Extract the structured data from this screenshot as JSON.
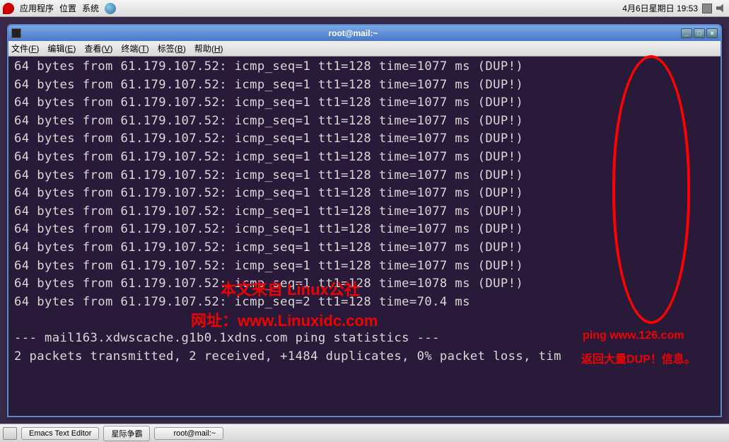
{
  "top_panel": {
    "menus": [
      "应用程序",
      "位置",
      "系统"
    ],
    "clock": "4月6日星期日 19:53"
  },
  "window": {
    "title": "root@mail:~",
    "menus": [
      {
        "label": "文件",
        "key": "F"
      },
      {
        "label": "编辑",
        "key": "E"
      },
      {
        "label": "查看",
        "key": "V"
      },
      {
        "label": "终端",
        "key": "T"
      },
      {
        "label": "标签",
        "key": "B"
      },
      {
        "label": "帮助",
        "key": "H"
      }
    ]
  },
  "terminal": {
    "lines": [
      "64 bytes from 61.179.107.52: icmp_seq=1 tt1=128 time=1077 ms (DUP!)",
      "64 bytes from 61.179.107.52: icmp_seq=1 tt1=128 time=1077 ms (DUP!)",
      "64 bytes from 61.179.107.52: icmp_seq=1 tt1=128 time=1077 ms (DUP!)",
      "64 bytes from 61.179.107.52: icmp_seq=1 tt1=128 time=1077 ms (DUP!)",
      "64 bytes from 61.179.107.52: icmp_seq=1 tt1=128 time=1077 ms (DUP!)",
      "64 bytes from 61.179.107.52: icmp_seq=1 tt1=128 time=1077 ms (DUP!)",
      "64 bytes from 61.179.107.52: icmp_seq=1 tt1=128 time=1077 ms (DUP!)",
      "64 bytes from 61.179.107.52: icmp_seq=1 tt1=128 time=1077 ms (DUP!)",
      "64 bytes from 61.179.107.52: icmp_seq=1 tt1=128 time=1077 ms (DUP!)",
      "64 bytes from 61.179.107.52: icmp_seq=1 tt1=128 time=1077 ms (DUP!)",
      "64 bytes from 61.179.107.52: icmp_seq=1 tt1=128 time=1077 ms (DUP!)",
      "64 bytes from 61.179.107.52: icmp_seq=1 tt1=128 time=1077 ms (DUP!)",
      "64 bytes from 61.179.107.52: icmp_seq=1 tt1=128 time=1078 ms (DUP!)",
      "64 bytes from 61.179.107.52: icmp_seq=2 tt1=128 time=70.4 ms",
      "",
      "--- mail163.xdwscache.g1b0.1xdns.com ping statistics ---",
      "2 packets transmitted, 2 received, +1484 duplicates, 0% packet loss, tim"
    ]
  },
  "annotations": {
    "watermark_line1": "本文来自 Linux公社",
    "watermark_line2": "网址：www.Linuxidc.com",
    "note1": "ping www.126.com",
    "note2": "返回大量DUP！信息。"
  },
  "taskbar": {
    "items": [
      "Emacs Text Editor",
      "星际争霸",
      "root@mail:~"
    ]
  }
}
